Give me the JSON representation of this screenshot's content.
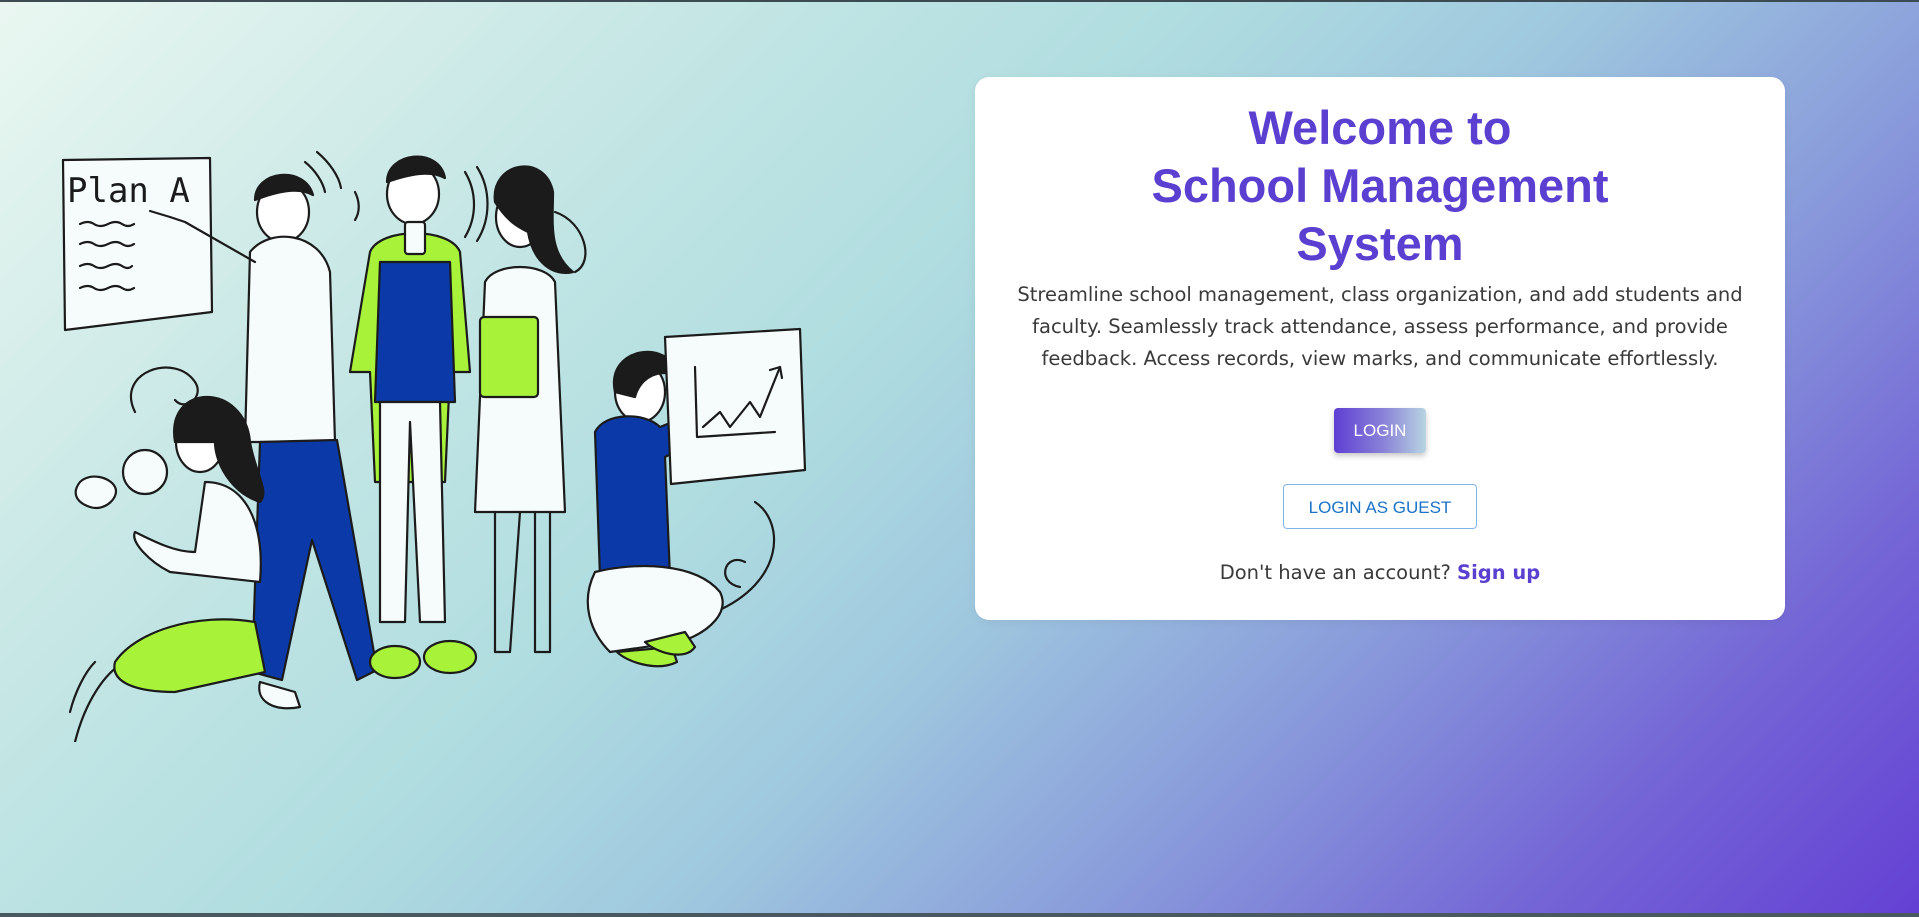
{
  "welcome": {
    "title_line1": "Welcome to",
    "title_line2": "School Management",
    "title_line3": "System",
    "description": "Streamline school management, class organization, and add students and faculty. Seamlessly track attendance, assess performance, and provide feedback. Access records, view marks, and communicate effortlessly.",
    "login_label": "LOGIN",
    "guest_label": "LOGIN AS GUEST",
    "signup_prompt": "Don't have an account?",
    "signup_link": "Sign up"
  },
  "illustration": {
    "whiteboard_text": "Plan A"
  },
  "colors": {
    "accent_purple": "#5a3fd0",
    "accent_lime": "#a8f23a",
    "accent_blue": "#0b3aa8",
    "guest_text": "#1a73c8"
  }
}
